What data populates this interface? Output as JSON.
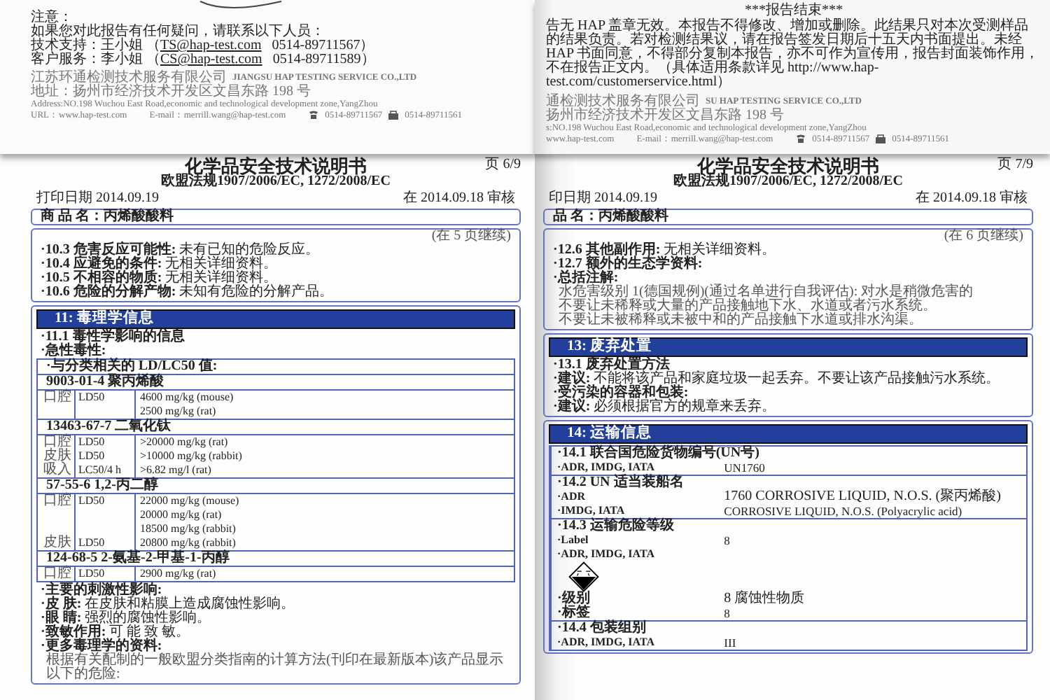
{
  "report_pages": [
    {
      "notice_title": "注意：",
      "notice_lead": "如果您对此报告有任何疑问，请联系以下人员：",
      "contacts": [
        {
          "label": "技术支持：王小姐 （",
          "email": "TS@hap-test.com",
          "phone": "0514-89711567）"
        },
        {
          "label": "客户服务：李小姐 （",
          "email": "CS@hap-test.com",
          "phone": "0514-89711589）"
        }
      ],
      "footer": {
        "company_cn": "江苏环通检测技术服务有限公司",
        "company_en": "JIANGSU HAP TESTING SERVICE CO.,LTD",
        "address_cn": "地址：扬州市经济技术开发区文昌东路 198 号",
        "address_en": "Address:NO.198 Wuchou East Road,economic and technological development zone,YangZhou",
        "url": "URL：www.hap-test.com",
        "email": "E-mail：merrill.wang@hap-test.com",
        "phone": "0514-89711567",
        "fax": "0514-89711561"
      }
    },
    {
      "end_marker": "***报告结束***",
      "disclaimer": "告无 HAP 盖章无效。本报告不得修改、增加或删除。此结果只对本次受测样品的结果负责。若对检测结果议，请在报告签发日期后十五天内书面提出。未经 HAP 书面同意，不得部分复制本报告，亦不可作为宣传用，报告封面装饰作用，不在报告正文内。（具体适用条款详见 http://www.hap-test.com/customerservice.html）",
      "footer": {
        "company_cn": "通检测技术服务有限公司",
        "company_en": "SU HAP TESTING SERVICE CO.,LTD",
        "address_cn": "扬州市经济技术开发区文昌东路 198 号",
        "address_en": "s:NO.198 Wuchou East Road,economic and technological development zone,YangZhou",
        "url": "www.hap-test.com",
        "email": "E-mail：merrill.wang@hap-test.com",
        "phone": "0514-89711567",
        "fax": "0514-89711561"
      }
    }
  ],
  "sds_pages": [
    {
      "page_number": "页 6/9",
      "title": "化学品安全技术说明书",
      "regulation": "欧盟法规1907/2006/EC, 1272/2008/EC",
      "print_date": "打印日期 2014.09.19",
      "review_date": "在 2014.09.18 审核",
      "product_label": "商 品 名：",
      "product_name": "丙烯酸酸料",
      "continued": "(在 5 页继续)",
      "sections": [
        {
          "items": [
            {
              "kind": "field",
              "label": "·10.3 危害反应可能性: ",
              "value": "未有已知的危险反应。"
            },
            {
              "kind": "field",
              "label": "·10.4 应避免的条件: ",
              "value": "无相关详细资料。"
            },
            {
              "kind": "field",
              "label": "·10.5 不相容的物质: ",
              "value": "无相关详细资料。"
            },
            {
              "kind": "field",
              "label": "·10.6 危险的分解产物: ",
              "value": "未知有危险的分解产品。"
            }
          ]
        },
        {
          "header": "11: 毒理学信息",
          "items": [
            {
              "kind": "heading",
              "text": "·11.1 毒性学影响的信息"
            },
            {
              "kind": "heading",
              "text": "·急性毒性:"
            },
            {
              "kind": "tox_table",
              "caption": "·与分类相关的 LD/LC50 值:",
              "groups": [
                {
                  "substance": "9003-01-4 聚丙烯酸",
                  "rows": [
                    {
                      "route": "口腔",
                      "measure": "LD50",
                      "value": "4600 mg/kg (mouse)"
                    },
                    {
                      "value": "2500 mg/kg (rat)"
                    }
                  ]
                },
                {
                  "substance": "13463-67-7 二氧化钛",
                  "rows": [
                    {
                      "route": "口腔",
                      "measure": "LD50",
                      "value": ">20000 mg/kg (rat)"
                    },
                    {
                      "route": "皮肤",
                      "measure": "LD50",
                      "value": ">10000 mg/kg (rabbit)"
                    },
                    {
                      "route": "吸入",
                      "measure": "LC50/4 h",
                      "value": ">6.82 mg/l (rat)"
                    }
                  ]
                },
                {
                  "substance": "57-55-6 1,2-丙二醇",
                  "rows": [
                    {
                      "route": "口腔",
                      "measure": "LD50",
                      "value": "22000 mg/kg (mouse)"
                    },
                    {
                      "value": "20000 mg/kg (rat)"
                    },
                    {
                      "value": "18500 mg/kg (rabbit)"
                    },
                    {
                      "route": "皮肤",
                      "measure": "LD50",
                      "value": "20800 mg/kg (rabbit)"
                    }
                  ]
                },
                {
                  "substance": "124-68-5 2-氨基-2-甲基-1-丙醇",
                  "rows": [
                    {
                      "route": "口腔",
                      "measure": "LD50",
                      "value": "2900 mg/kg (rat)"
                    }
                  ]
                }
              ]
            },
            {
              "kind": "heading",
              "text": "·主要的刺激性影响:"
            },
            {
              "kind": "field",
              "label": "·皮 肤: ",
              "value": "在皮肤和粘膜上造成腐蚀性影响。"
            },
            {
              "kind": "field",
              "label": "·眼 睛: ",
              "value": "强烈的腐蚀性影响。"
            },
            {
              "kind": "field",
              "label": "·致敏作用: ",
              "value": "可 能 致 敏。"
            },
            {
              "kind": "heading",
              "text": "·更多毒理学的资料:"
            },
            {
              "kind": "text",
              "text": "根据有关配制的一般欧盟分类指南的计算方法(刊印在最新版本)该产品显示以下的危险:"
            }
          ]
        }
      ]
    },
    {
      "page_number": "页 7/9",
      "title": "化学品安全技术说明书",
      "regulation": "欧盟法规1907/2006/EC, 1272/2008/EC",
      "print_date": "印日期 2014.09.19",
      "review_date": "在 2014.09.18 审核",
      "product_label": "品 名：",
      "product_name": "丙烯酸酸料",
      "continued": "(在 6 页继续)",
      "sections": [
        {
          "items": [
            {
              "kind": "field",
              "label": "·12.6 其他副作用: ",
              "value": "无相关详细资料。"
            },
            {
              "kind": "heading",
              "text": "·12.7 额外的生态学资料:"
            },
            {
              "kind": "heading",
              "text": "·总括注解:"
            },
            {
              "kind": "text",
              "text": "水危害级别 1(德国规例)(通过名单进行自我评估): 对水是稍微危害的"
            },
            {
              "kind": "text",
              "text": "不要让未稀释或大量的产品接触地下水、水道或者污水系统。"
            },
            {
              "kind": "text",
              "text": "不要让未被稀释或未被中和的产品接触下水道或排水沟渠。"
            }
          ]
        },
        {
          "header": "13: 废弃处置",
          "items": [
            {
              "kind": "heading",
              "text": "·13.1 废弃处置方法"
            },
            {
              "kind": "field",
              "label": "·建议: ",
              "value": "不能将该产品和家庭垃圾一起丢弃。不要让该产品接触污水系统。"
            },
            {
              "kind": "heading",
              "text": "·受污染的容器和包装:"
            },
            {
              "kind": "field",
              "label": "·建议: ",
              "value": "必须根据官方的规章来丢弃。"
            }
          ]
        },
        {
          "header": "14: 运输信息",
          "items": [
            {
              "kind": "transport",
              "groups": [
                {
                  "lines": [
                    {
                      "label": "·14.1 联合国危险货物编号(UN号)"
                    },
                    {
                      "label": "·ADR, IMDG, IATA",
                      "value": "UN1760"
                    }
                  ]
                },
                {
                  "lines": [
                    {
                      "label": "·14.2 UN 适当装船名"
                    },
                    {
                      "label": "·ADR",
                      "value": "1760 CORROSIVE LIQUID, N.O.S. (聚丙烯酸)"
                    },
                    {
                      "label": "·IMDG, IATA",
                      "value": "CORROSIVE LIQUID, N.O.S. (Polyacrylic acid)"
                    }
                  ]
                },
                {
                  "lines": [
                    {
                      "label": "·14.3 运输危险等级"
                    },
                    {
                      "label": "·Label",
                      "value": "8"
                    },
                    {
                      "label": "·ADR, IMDG, IATA"
                    },
                    {
                      "kind": "pictogram"
                    },
                    {
                      "label": "·级别",
                      "value": "8 腐蚀性物质"
                    },
                    {
                      "label": "·标签",
                      "value": "8"
                    }
                  ]
                },
                {
                  "lines": [
                    {
                      "label": "·14.4 包装组别"
                    },
                    {
                      "label": "·ADR, IMDG, IATA",
                      "value": "III"
                    }
                  ]
                }
              ]
            }
          ]
        }
      ]
    }
  ]
}
